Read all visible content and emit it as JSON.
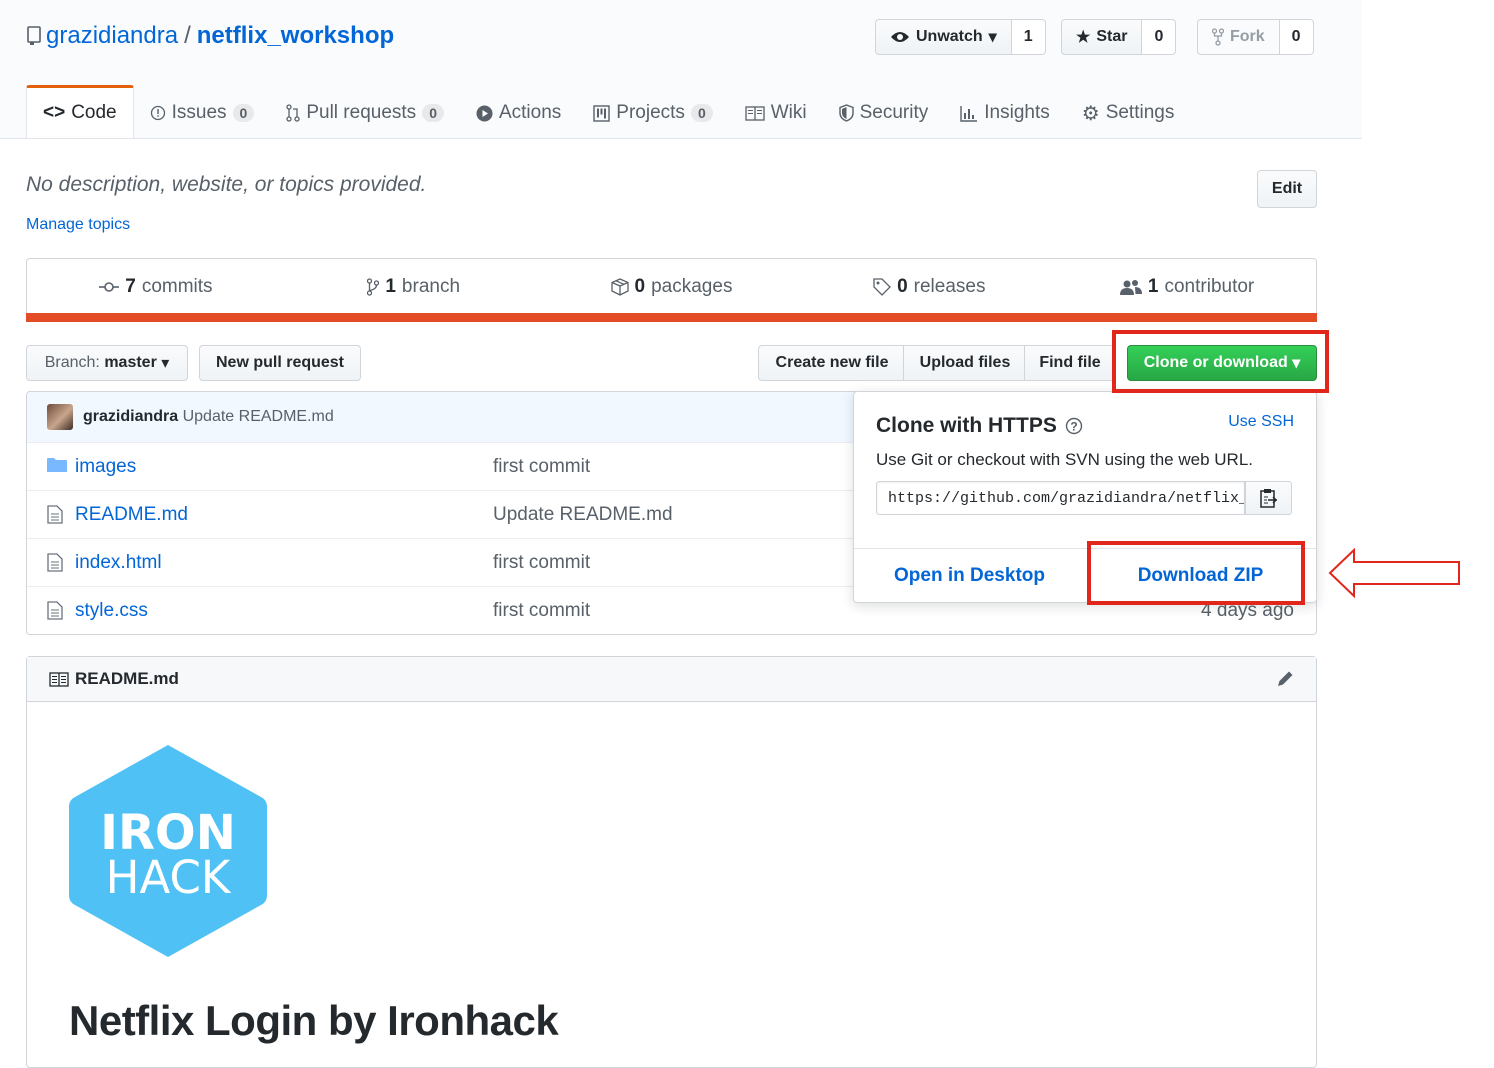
{
  "repo": {
    "owner": "grazidiandra",
    "separator": "/",
    "name": "netflix_workshop"
  },
  "actions": {
    "watch": {
      "label": "Unwatch",
      "count": "1"
    },
    "star": {
      "label": "Star",
      "count": "0"
    },
    "fork": {
      "label": "Fork",
      "count": "0"
    }
  },
  "tabs": [
    {
      "label": "Code"
    },
    {
      "label": "Issues",
      "count": "0"
    },
    {
      "label": "Pull requests",
      "count": "0"
    },
    {
      "label": "Actions"
    },
    {
      "label": "Projects",
      "count": "0"
    },
    {
      "label": "Wiki"
    },
    {
      "label": "Security"
    },
    {
      "label": "Insights"
    },
    {
      "label": "Settings"
    }
  ],
  "description": "No description, website, or topics provided.",
  "manage_topics": "Manage topics",
  "edit_label": "Edit",
  "summary": {
    "commits": {
      "num": "7",
      "label": "commits"
    },
    "branches": {
      "num": "1",
      "label": "branch"
    },
    "packages": {
      "num": "0",
      "label": "packages"
    },
    "releases": {
      "num": "0",
      "label": "releases"
    },
    "contributors": {
      "num": "1",
      "label": "contributor"
    }
  },
  "language_color": "#e34c26",
  "file_nav": {
    "branch_prefix": "Branch:",
    "branch_name": "master",
    "new_pr": "New pull request",
    "create_file": "Create new file",
    "upload_files": "Upload files",
    "find_file": "Find file",
    "clone": "Clone or download"
  },
  "latest_commit": {
    "author": "grazidiandra",
    "message": "Update README.md"
  },
  "files": [
    {
      "name": "images",
      "type": "folder",
      "message": "first commit",
      "age": ""
    },
    {
      "name": "README.md",
      "type": "file",
      "message": "Update README.md",
      "age": ""
    },
    {
      "name": "index.html",
      "type": "file",
      "message": "first commit",
      "age": ""
    },
    {
      "name": "style.css",
      "type": "file",
      "message": "first commit",
      "age": "4 days ago"
    }
  ],
  "clone_dropdown": {
    "title": "Clone with HTTPS",
    "use_ssh": "Use SSH",
    "description": "Use Git or checkout with SVN using the web URL.",
    "url": "https://github.com/grazidiandra/netflix_workshop.git",
    "open_desktop": "Open in Desktop",
    "download_zip": "Download ZIP"
  },
  "highlight_color": "#e1261c",
  "readme": {
    "filename": "README.md",
    "logo_line1": "IRON",
    "logo_line2": "HACK",
    "logo_color": "#4fc1f5",
    "heading": "Netflix Login by Ironhack"
  }
}
